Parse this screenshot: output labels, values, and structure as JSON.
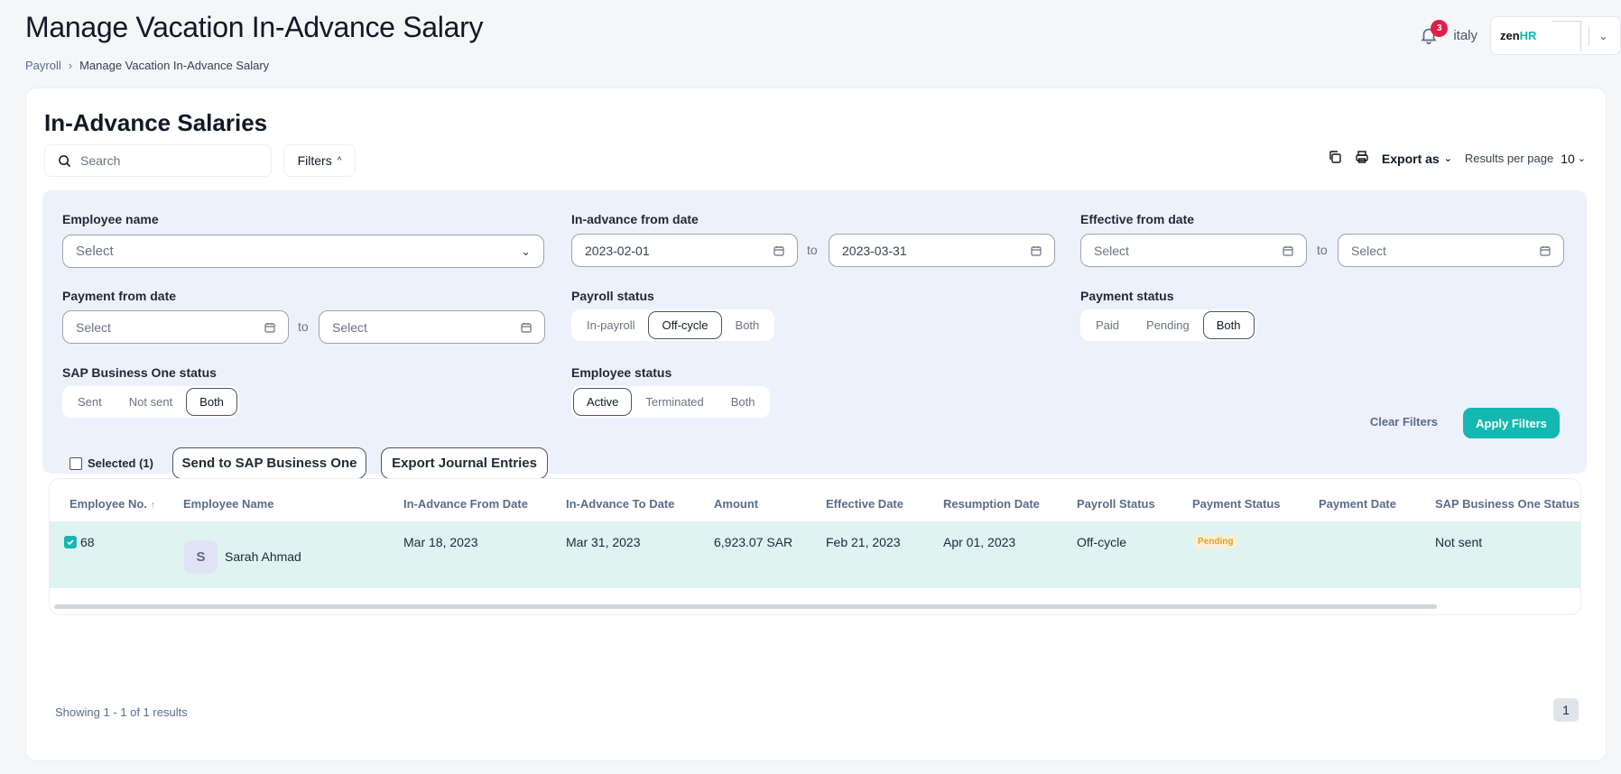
{
  "header": {
    "title": "Manage Vacation In-Advance Salary",
    "breadcrumb": {
      "parent": "Payroll",
      "current": "Manage Vacation In-Advance Salary"
    },
    "notification_count": "3",
    "user_name": "italy",
    "logo_text": "zen",
    "logo_accent": "HR"
  },
  "card": {
    "title": "In-Advance Salaries",
    "search_placeholder": "Search",
    "filters_label": "Filters",
    "export_label": "Export as",
    "results_per_page_label": "Results per page",
    "results_per_page_value": "10"
  },
  "filters": {
    "employee_name": {
      "label": "Employee name",
      "placeholder": "Select"
    },
    "in_advance_from_date": {
      "label": "In-advance from date",
      "from": "2023-02-01",
      "to": "2023-03-31"
    },
    "effective_from_date": {
      "label": "Effective from date",
      "from": "Select",
      "to": "Select"
    },
    "payment_from_date": {
      "label": "Payment from date",
      "from": "Select",
      "to": "Select"
    },
    "to_text": "to",
    "payroll_status": {
      "label": "Payroll status",
      "options": [
        "In-payroll",
        "Off-cycle",
        "Both"
      ],
      "selected": "Off-cycle"
    },
    "payment_status": {
      "label": "Payment status",
      "options": [
        "Paid",
        "Pending",
        "Both"
      ],
      "selected": "Both"
    },
    "sap_status": {
      "label": "SAP Business One status",
      "options": [
        "Sent",
        "Not sent",
        "Both"
      ],
      "selected": "Both"
    },
    "employee_status": {
      "label": "Employee status",
      "options": [
        "Active",
        "Terminated",
        "Both"
      ],
      "selected": "Active"
    },
    "clear_label": "Clear Filters",
    "apply_label": "Apply Filters"
  },
  "actions": {
    "selected_label": "Selected (1)",
    "send_sap_label": "Send to SAP Business One",
    "export_journal_label": "Export Journal Entries"
  },
  "table": {
    "columns": [
      "Employee No.",
      "Employee Name",
      "In-Advance From Date",
      "In-Advance To Date",
      "Amount",
      "Effective Date",
      "Resumption Date",
      "Payroll Status",
      "Payment Status",
      "Payment Date",
      "SAP Business One Status"
    ],
    "rows": [
      {
        "employee_no": "68",
        "avatar_initial": "S",
        "employee_name": "Sarah Ahmad",
        "from_date": "Mar 18, 2023",
        "to_date": "Mar 31, 2023",
        "amount": "6,923.07 SAR",
        "effective_date": "Feb 21, 2023",
        "resumption_date": "Apr 01, 2023",
        "payroll_status": "Off-cycle",
        "payment_status": "Pending",
        "payment_date": "",
        "sap_status": "Not sent"
      }
    ]
  },
  "footer": {
    "showing": "Showing 1 - 1 of 1 results",
    "page": "1"
  },
  "colors": {
    "accent": "#14b8b0",
    "badge": "#e11d48",
    "panel": "#edf1fb",
    "row_selected": "#dff3f1"
  }
}
